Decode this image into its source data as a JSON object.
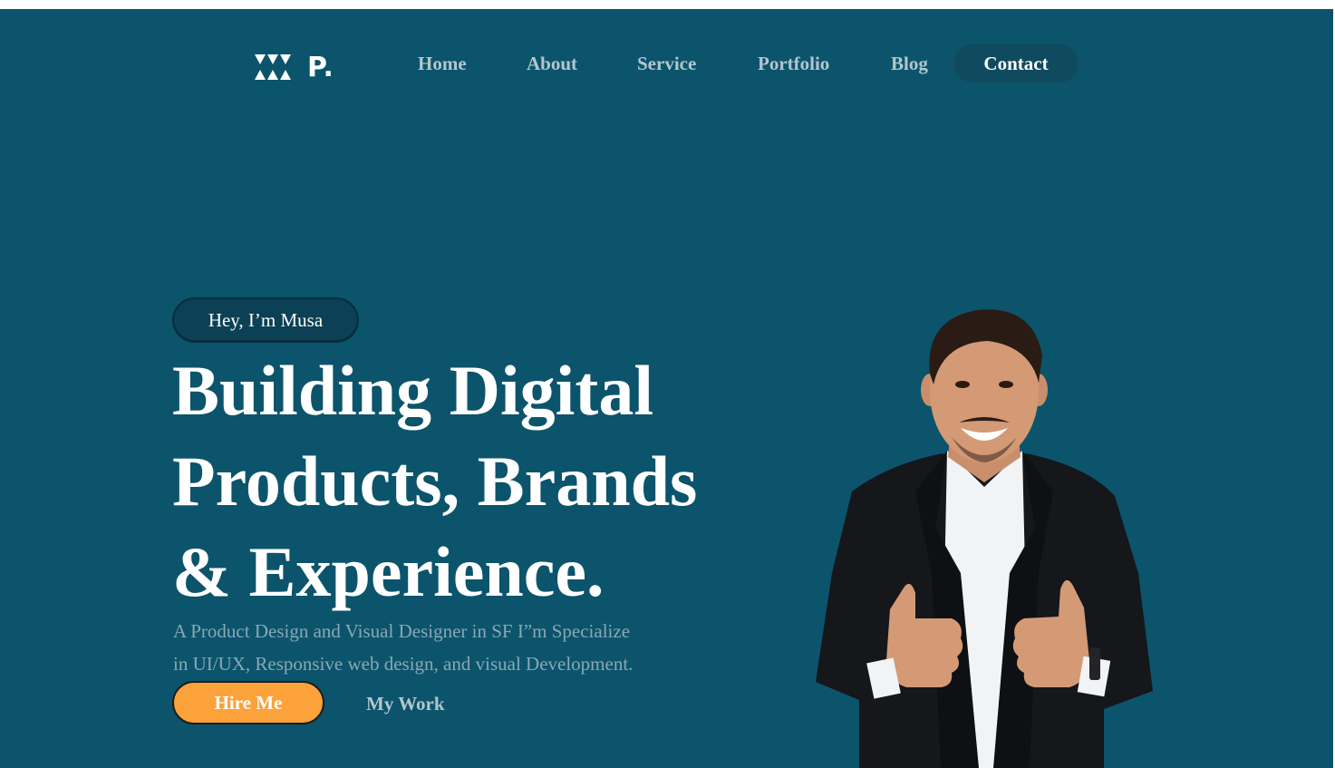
{
  "header": {
    "logo_text": "P.",
    "nav": {
      "home": "Home",
      "about": "About",
      "service": "Service",
      "portfolio": "Portfolio",
      "blog": "Blog",
      "contact": "Contact"
    }
  },
  "hero": {
    "badge": "Hey, I’m Musa",
    "headline": {
      "line1": "Building Digital",
      "line2": "Products, Brands",
      "line3": "& Experience."
    },
    "subtext": {
      "line1": "A Product Design and Visual Designer in SF I”m Specialize",
      "line2": "in UI/UX, Responsive web design, and visual Development."
    },
    "buttons": {
      "hire": "Hire Me",
      "work": "My Work"
    },
    "portrait_icon": "smiling-man-thumbs-up-photo"
  },
  "colors": {
    "background": "#0b546c",
    "accent": "#fba23a",
    "contact_pill": "#0f4a5f",
    "nav_text": "#b3c6cd"
  }
}
